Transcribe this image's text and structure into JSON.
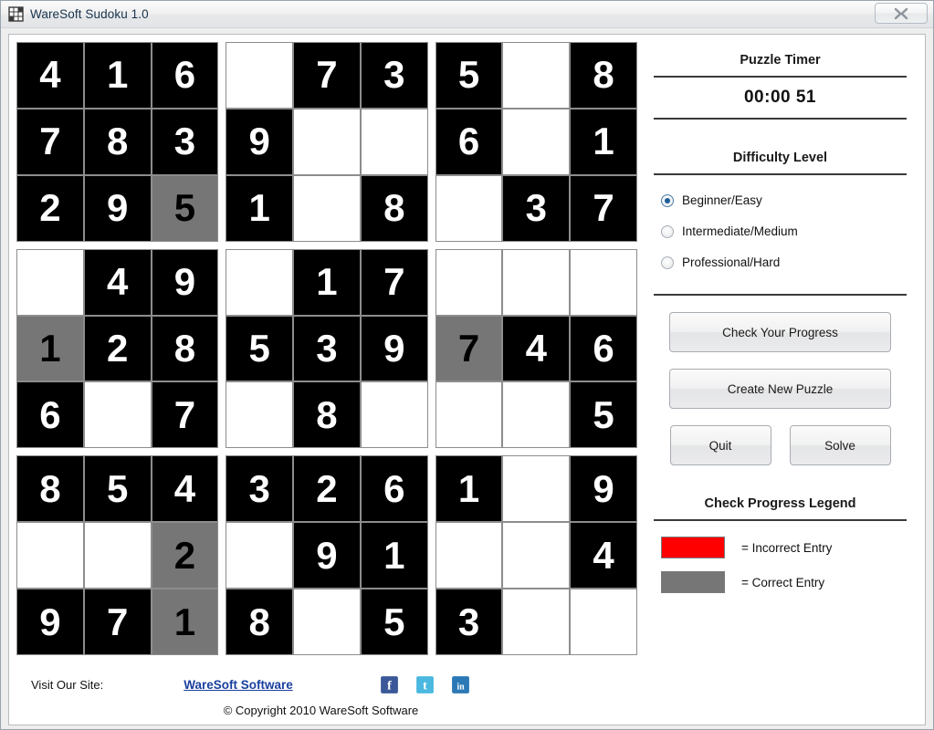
{
  "window": {
    "title": "WareSoft Sudoku 1.0",
    "icon": "sudoku-grid-icon",
    "close_label": "X"
  },
  "board": {
    "rows": [
      [
        {
          "v": "4",
          "s": "filled"
        },
        {
          "v": "1",
          "s": "filled"
        },
        {
          "v": "6",
          "s": "filled"
        },
        {
          "v": "",
          "s": "empty"
        },
        {
          "v": "7",
          "s": "filled"
        },
        {
          "v": "3",
          "s": "filled"
        },
        {
          "v": "5",
          "s": "filled"
        },
        {
          "v": "",
          "s": "empty"
        },
        {
          "v": "8",
          "s": "filled"
        }
      ],
      [
        {
          "v": "7",
          "s": "filled"
        },
        {
          "v": "8",
          "s": "filled"
        },
        {
          "v": "3",
          "s": "filled"
        },
        {
          "v": "9",
          "s": "filled"
        },
        {
          "v": "",
          "s": "empty"
        },
        {
          "v": "",
          "s": "empty"
        },
        {
          "v": "6",
          "s": "filled"
        },
        {
          "v": "",
          "s": "empty"
        },
        {
          "v": "1",
          "s": "filled"
        }
      ],
      [
        {
          "v": "2",
          "s": "filled"
        },
        {
          "v": "9",
          "s": "filled"
        },
        {
          "v": "5",
          "s": "correct"
        },
        {
          "v": "1",
          "s": "filled"
        },
        {
          "v": "",
          "s": "empty"
        },
        {
          "v": "8",
          "s": "filled"
        },
        {
          "v": "",
          "s": "empty"
        },
        {
          "v": "3",
          "s": "filled"
        },
        {
          "v": "7",
          "s": "filled"
        }
      ],
      [
        {
          "v": "",
          "s": "empty"
        },
        {
          "v": "4",
          "s": "filled"
        },
        {
          "v": "9",
          "s": "filled"
        },
        {
          "v": "",
          "s": "empty"
        },
        {
          "v": "1",
          "s": "filled"
        },
        {
          "v": "7",
          "s": "filled"
        },
        {
          "v": "",
          "s": "empty"
        },
        {
          "v": "",
          "s": "empty"
        },
        {
          "v": "",
          "s": "empty"
        }
      ],
      [
        {
          "v": "1",
          "s": "correct"
        },
        {
          "v": "2",
          "s": "filled"
        },
        {
          "v": "8",
          "s": "filled"
        },
        {
          "v": "5",
          "s": "filled"
        },
        {
          "v": "3",
          "s": "filled"
        },
        {
          "v": "9",
          "s": "filled"
        },
        {
          "v": "7",
          "s": "correct"
        },
        {
          "v": "4",
          "s": "filled"
        },
        {
          "v": "6",
          "s": "filled"
        }
      ],
      [
        {
          "v": "6",
          "s": "filled"
        },
        {
          "v": "",
          "s": "empty"
        },
        {
          "v": "7",
          "s": "filled"
        },
        {
          "v": "",
          "s": "empty"
        },
        {
          "v": "8",
          "s": "filled"
        },
        {
          "v": "",
          "s": "empty"
        },
        {
          "v": "",
          "s": "empty"
        },
        {
          "v": "",
          "s": "empty"
        },
        {
          "v": "5",
          "s": "filled"
        }
      ],
      [
        {
          "v": "8",
          "s": "filled"
        },
        {
          "v": "5",
          "s": "filled"
        },
        {
          "v": "4",
          "s": "filled"
        },
        {
          "v": "3",
          "s": "filled"
        },
        {
          "v": "2",
          "s": "filled"
        },
        {
          "v": "6",
          "s": "filled"
        },
        {
          "v": "1",
          "s": "filled"
        },
        {
          "v": "",
          "s": "empty"
        },
        {
          "v": "9",
          "s": "filled"
        }
      ],
      [
        {
          "v": "",
          "s": "empty"
        },
        {
          "v": "",
          "s": "empty"
        },
        {
          "v": "2",
          "s": "correct"
        },
        {
          "v": "",
          "s": "empty"
        },
        {
          "v": "9",
          "s": "filled"
        },
        {
          "v": "1",
          "s": "filled"
        },
        {
          "v": "",
          "s": "empty"
        },
        {
          "v": "",
          "s": "empty"
        },
        {
          "v": "4",
          "s": "filled"
        }
      ],
      [
        {
          "v": "9",
          "s": "filled"
        },
        {
          "v": "7",
          "s": "filled"
        },
        {
          "v": "1",
          "s": "correct"
        },
        {
          "v": "8",
          "s": "filled"
        },
        {
          "v": "",
          "s": "empty"
        },
        {
          "v": "5",
          "s": "filled"
        },
        {
          "v": "3",
          "s": "filled"
        },
        {
          "v": "",
          "s": "empty"
        },
        {
          "v": "",
          "s": "empty"
        }
      ]
    ]
  },
  "sidebar": {
    "timer_heading": "Puzzle Timer",
    "timer_value": "00:00 51",
    "difficulty_heading": "Difficulty Level",
    "difficulty_options": [
      {
        "label": "Beginner/Easy",
        "selected": true
      },
      {
        "label": "Intermediate/Medium",
        "selected": false
      },
      {
        "label": "Professional/Hard",
        "selected": false
      }
    ],
    "check_progress_label": "Check Your Progress",
    "create_puzzle_label": "Create New Puzzle",
    "quit_label": "Quit",
    "solve_label": "Solve",
    "legend_heading": "Check Progress Legend",
    "legend_items": [
      {
        "color": "#ff0000",
        "label": "= Incorrect Entry"
      },
      {
        "color": "#767676",
        "label": "= Correct Entry"
      }
    ]
  },
  "footer": {
    "visit_label": "Visit Our Site:",
    "site_link": "WareSoft Software",
    "copyright": "© Copyright 2010 WareSoft Software",
    "social": [
      {
        "name": "facebook-icon",
        "color": "#3b5998",
        "glyph": "f"
      },
      {
        "name": "twitter-icon",
        "color": "#4bb8e0",
        "glyph": "t"
      },
      {
        "name": "linkedin-icon",
        "color": "#2a78b5",
        "glyph": "in"
      }
    ]
  }
}
